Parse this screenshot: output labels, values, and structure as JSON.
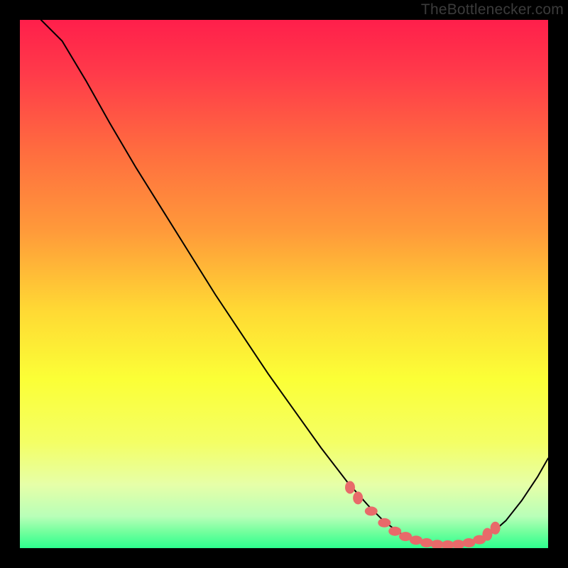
{
  "attribution": "TheBottlenecker.com",
  "chart_data": {
    "type": "line",
    "title": "",
    "xlabel": "",
    "ylabel": "",
    "xlim": [
      0,
      100
    ],
    "ylim": [
      0,
      100
    ],
    "grid": false,
    "legend": false,
    "background": {
      "type": "vertical-gradient",
      "stops": [
        {
          "offset": 0.0,
          "color": "#ff1f4b"
        },
        {
          "offset": 0.1,
          "color": "#ff3a4a"
        },
        {
          "offset": 0.25,
          "color": "#ff6d3f"
        },
        {
          "offset": 0.4,
          "color": "#ff9a3a"
        },
        {
          "offset": 0.55,
          "color": "#ffd934"
        },
        {
          "offset": 0.68,
          "color": "#fbff36"
        },
        {
          "offset": 0.8,
          "color": "#f4ff65"
        },
        {
          "offset": 0.88,
          "color": "#e6ffa8"
        },
        {
          "offset": 0.94,
          "color": "#b8ffb8"
        },
        {
          "offset": 0.97,
          "color": "#71ff9d"
        },
        {
          "offset": 1.0,
          "color": "#2dff8e"
        }
      ]
    },
    "series": [
      {
        "name": "curve",
        "color": "#000000",
        "x": [
          4.0,
          8.0,
          12.5,
          17.0,
          22.0,
          27.0,
          32.0,
          37.0,
          42.0,
          47.0,
          52.0,
          57.0,
          62.0,
          66.0,
          69.0,
          72.0,
          75.0,
          78.0,
          81.0,
          84.0,
          87.0,
          89.5,
          92.0,
          95.0,
          98.0,
          100.0
        ],
        "values": [
          100.0,
          96.0,
          88.5,
          80.5,
          72.0,
          64.0,
          56.0,
          48.0,
          40.5,
          33.0,
          26.0,
          19.0,
          12.5,
          8.0,
          5.0,
          2.8,
          1.5,
          0.8,
          0.5,
          0.7,
          1.5,
          3.0,
          5.2,
          9.0,
          13.5,
          17.0
        ]
      }
    ],
    "markers": {
      "color": "#e86a6a",
      "x": [
        62.5,
        64.0,
        66.5,
        69.0,
        71.0,
        73.0,
        75.0,
        77.0,
        79.0,
        81.0,
        83.0,
        85.0,
        87.0,
        88.5,
        90.0
      ],
      "y": [
        11.5,
        9.5,
        7.0,
        4.8,
        3.2,
        2.2,
        1.5,
        1.0,
        0.7,
        0.6,
        0.7,
        1.0,
        1.6,
        2.6,
        3.8
      ]
    }
  }
}
